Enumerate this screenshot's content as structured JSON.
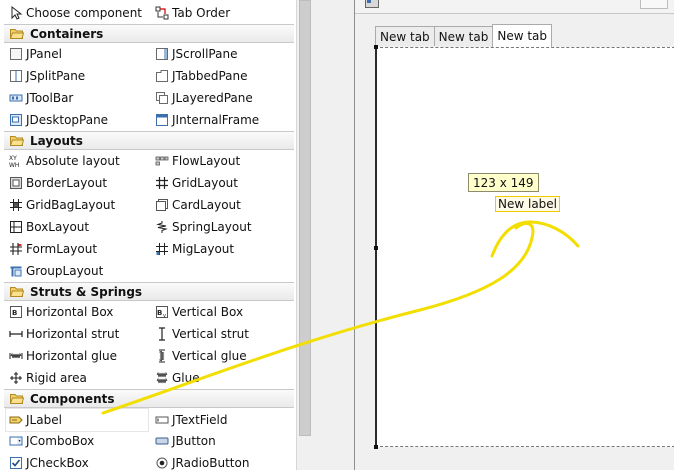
{
  "palette": {
    "top": {
      "choose_component": "Choose component",
      "tab_order": "Tab Order"
    },
    "categories": {
      "containers": "Containers",
      "layouts": "Layouts",
      "struts_springs": "Struts & Springs",
      "components": "Components"
    },
    "containers": {
      "jpanel": "JPanel",
      "jscrollpane": "JScrollPane",
      "jsplitpane": "JSplitPane",
      "jtabbedpane": "JTabbedPane",
      "jtoolbar": "JToolBar",
      "jlayeredpane": "JLayeredPane",
      "jdesktoppane": "JDesktopPane",
      "jinternalframe": "JInternalFrame"
    },
    "layouts": {
      "absolute": "Absolute layout",
      "flow": "FlowLayout",
      "border": "BorderLayout",
      "grid": "GridLayout",
      "gridbag": "GridBagLayout",
      "card": "CardLayout",
      "box": "BoxLayout",
      "spring": "SpringLayout",
      "form": "FormLayout",
      "mig": "MigLayout",
      "group": "GroupLayout"
    },
    "struts": {
      "horizontal_box": "Horizontal Box",
      "vertical_box": "Vertical Box",
      "horizontal_strut": "Horizontal strut",
      "vertical_strut": "Vertical strut",
      "horizontal_glue": "Horizontal glue",
      "vertical_glue": "Vertical glue",
      "rigid_area": "Rigid area",
      "glue": "Glue"
    },
    "components": {
      "jlabel": "JLabel",
      "jtextfield": "JTextField",
      "jcombobox": "JComboBox",
      "jbutton": "JButton",
      "jcheckbox": "JCheckBox",
      "jradiobutton": "JRadioButton"
    }
  },
  "canvas": {
    "tabs": [
      "New tab",
      "New tab",
      "New tab"
    ],
    "active_tab_index": 2,
    "size_tooltip": "123 x 149",
    "new_label": "New label"
  },
  "colors": {
    "annotation_arrow": "#f2de00",
    "tooltip_bg": "#ffffcc",
    "category_bg": "#eeeeee"
  }
}
